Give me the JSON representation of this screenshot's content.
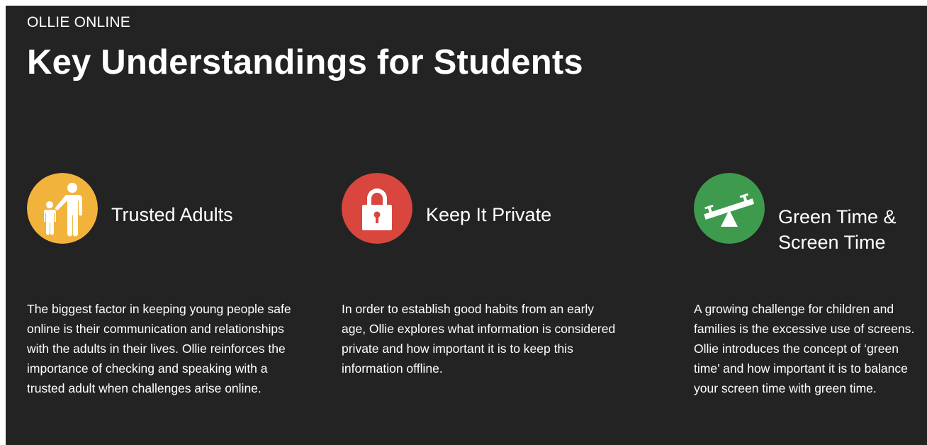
{
  "header": {
    "eyebrow": "OLLIE ONLINE",
    "title": "Key Understandings for Students"
  },
  "columns": [
    {
      "icon": "trusted-adults-icon",
      "icon_color": "#F2B33D",
      "title": "Trusted Adults",
      "body": "The biggest factor in keeping young people safe online is their communication and relationships with the adults in their lives. Ollie reinforces the importance of checking and speaking with a trusted adult when challenges arise online."
    },
    {
      "icon": "padlock-icon",
      "icon_color": "#D9463E",
      "title": "Keep It Private",
      "body": "In order to establish good habits from an early age, Ollie explores what information is considered private and how important it is to keep this information offline."
    },
    {
      "icon": "seesaw-icon",
      "icon_color": "#3E9B4E",
      "title": "Green Time &\nScreen Time",
      "body": "A growing challenge for children and families is the excessive use of screens. Ollie introduces the concept of ‘green time’ and how important it is to balance your screen time with green time."
    }
  ],
  "colors": {
    "panel_background": "#232323",
    "text": "#FFFFFF"
  }
}
